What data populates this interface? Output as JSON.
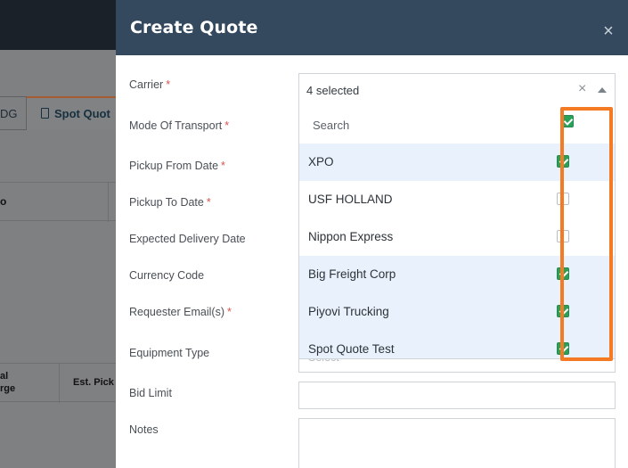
{
  "background": {
    "tab_left_label": "DG",
    "tab_spot_label": "Spot Quot",
    "table_header_text": "o",
    "table2_col1": "al\nrge",
    "table2_col2": "Est. Pick"
  },
  "modal": {
    "title": "Create Quote",
    "close_symbol": "×"
  },
  "form": {
    "labels": {
      "carrier": "Carrier",
      "mode_of_transport": "Mode Of Transport",
      "pickup_from_date": "Pickup From Date",
      "pickup_to_date": "Pickup To Date",
      "expected_delivery_date": "Expected Delivery Date",
      "currency_code": "Currency Code",
      "requester_emails": "Requester Email(s)",
      "equipment_type": "Equipment Type",
      "bid_limit": "Bid Limit",
      "notes": "Notes"
    },
    "required_mark": "*",
    "carrier_value": "4 selected",
    "carrier_clear": "×",
    "equipment_placeholder": "Select",
    "bid_limit_value": "",
    "notes_value": ""
  },
  "carrier_dropdown": {
    "search_placeholder": "Search",
    "select_all_checked": true,
    "items": [
      {
        "label": "XPO",
        "checked": true
      },
      {
        "label": "USF HOLLAND",
        "checked": false
      },
      {
        "label": "Nippon Express",
        "checked": false
      },
      {
        "label": "Big Freight Corp",
        "checked": true
      },
      {
        "label": "Piyovi Trucking",
        "checked": true
      },
      {
        "label": "Spot Quote Test",
        "checked": true
      }
    ]
  },
  "colors": {
    "header_bg": "#34495e",
    "check_green": "#2aa15a",
    "selected_row_bg": "#e9f2fc",
    "annotation_orange": "#f47a23",
    "required_red": "#d9534f"
  },
  "icons": {
    "close": "close-icon",
    "clear": "clear-icon",
    "caret": "caret-up-icon",
    "document": "document-icon"
  }
}
